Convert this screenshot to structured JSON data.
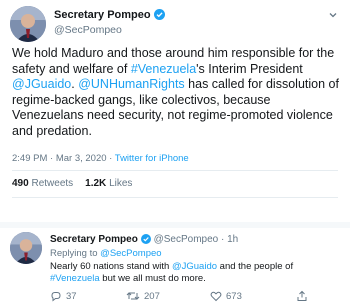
{
  "tweet": {
    "author_name": "Secretary Pompeo",
    "author_handle": "@SecPompeo",
    "body_parts": [
      "We hold Maduro and those around him responsible for the safety and welfare of ",
      "#Venezuela",
      "'s Interim President ",
      "@JGuaido",
      ". ",
      "@UNHumanRights",
      " has called for dissolution of regime-backed gangs, like colectivos, because Venezuelans need security, not regime-promoted violence and predation."
    ],
    "timestamp": "2:49 PM · Mar 3, 2020 · ",
    "source": "Twitter for iPhone",
    "retweets_count": "490",
    "retweets_label": "Retweets",
    "likes_count": "1.2K",
    "likes_label": "Likes"
  },
  "reply": {
    "author_name": "Secretary Pompeo",
    "meta": "@SecPompeo · 1h",
    "replying_prefix": "Replying to ",
    "replying_to": "@SecPompeo",
    "text_parts": [
      "Nearly 60 nations stand with ",
      "@JGuaido",
      " and the people of ",
      "#Venezuela",
      " but we all must do more."
    ],
    "replies_count": "37",
    "retweets_count": "207",
    "likes_count": "673"
  },
  "colors": {
    "link": "#1da1f2",
    "secondary_text": "#657786",
    "divider": "#e6ecf0"
  },
  "icons": [
    "verified-badge-icon",
    "chevron-down-icon",
    "reply-icon",
    "retweet-icon",
    "like-icon",
    "share-icon"
  ]
}
